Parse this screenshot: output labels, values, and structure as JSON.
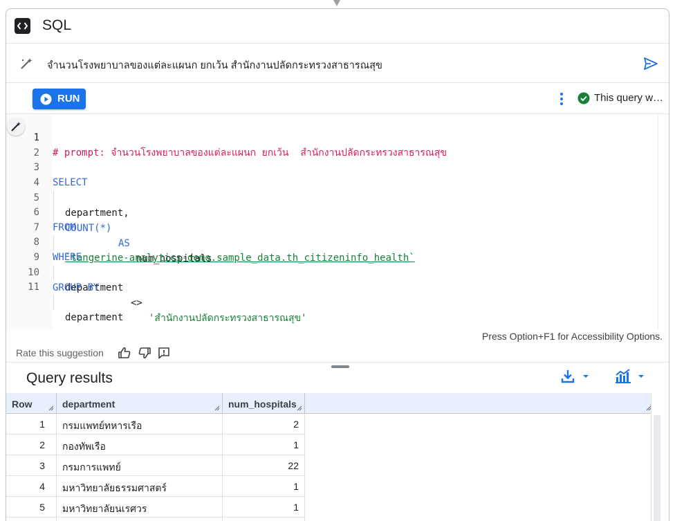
{
  "header": {
    "title": "SQL",
    "icon": "code-icon"
  },
  "prompt": {
    "text": "จำนวนโรงพยาบาลของแต่ละแผนก ยกเว้น  สำนักงานปลัดกระทรวงสาธารณสุข"
  },
  "toolbar": {
    "run_label": "RUN",
    "validation_text": "This query w…",
    "accent": "#1a73e8",
    "success_color": "#188038"
  },
  "editor": {
    "line_numbers": [
      "1",
      "2",
      "3",
      "4",
      "5",
      "6",
      "7",
      "8",
      "9",
      "10",
      "11"
    ],
    "comment": "# prompt: จำนวนโรงพยาบาลของแต่ละแผนก ยกเว้น  สำนักงานปลัดกระทรวงสาธารณสุข",
    "kw_select": "SELECT",
    "col_department": "department,",
    "fn_count": "COUNT(*)",
    "kw_as": "AS",
    "alias": "num_hospitals",
    "kw_from": "FROM",
    "table_ref": "`tangerine-analytics-demo.sample_data.th_citizeninfo_health`",
    "kw_where": "WHERE",
    "where_col": "department",
    "where_op": "<>",
    "where_val": "'สำนักงานปลัดกระทรวงสาธารณสุข'",
    "kw_group_by": "GROUP BY",
    "group_col": "department",
    "accessibility_hint": "Press Option+F1 for Accessibility Options."
  },
  "feedback": {
    "rate_label": "Rate this suggestion"
  },
  "results": {
    "title": "Query results",
    "columns": [
      "Row",
      "department",
      "num_hospitals"
    ],
    "rows": [
      {
        "row": "1",
        "department": "กรมแพทย์ทหารเรือ",
        "num_hospitals": "2"
      },
      {
        "row": "2",
        "department": "กองทัพเรือ",
        "num_hospitals": "1"
      },
      {
        "row": "3",
        "department": "กรมการแพทย์",
        "num_hospitals": "22"
      },
      {
        "row": "4",
        "department": "มหาวิทยาลัยธรรมศาสตร์",
        "num_hospitals": "1"
      },
      {
        "row": "5",
        "department": "มหาวิทยาลัยนเรศวร",
        "num_hospitals": "1"
      }
    ]
  }
}
